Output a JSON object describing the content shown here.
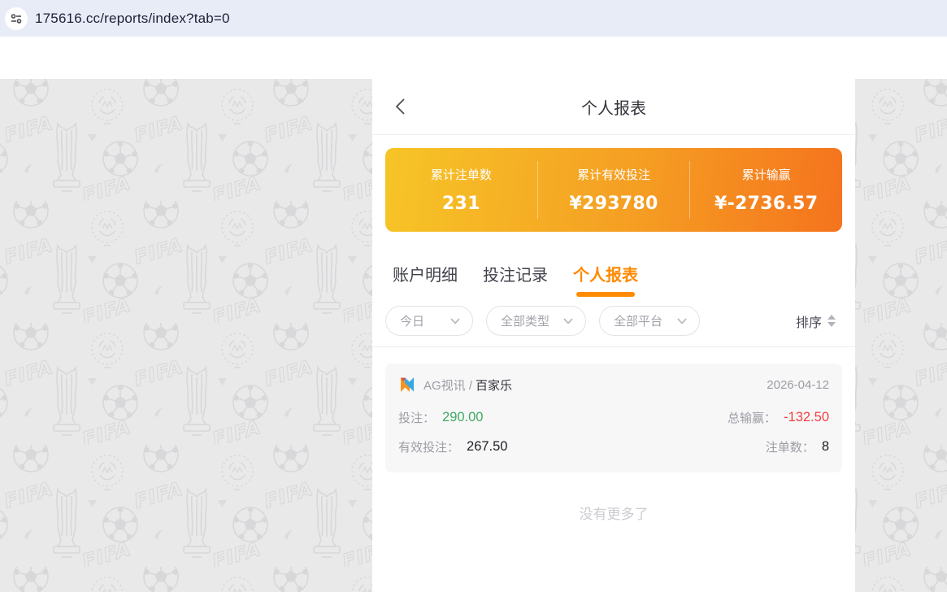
{
  "browser": {
    "url": "175616.cc/reports/index?tab=0"
  },
  "header": {
    "title": "个人报表"
  },
  "stats": {
    "items": [
      {
        "label": "累计注单数",
        "value": "231"
      },
      {
        "label": "累计有效投注",
        "value": "¥293780"
      },
      {
        "label": "累计输赢",
        "value": "¥-2736.57"
      }
    ]
  },
  "tabs": [
    {
      "label": "账户明细",
      "active": false
    },
    {
      "label": "投注记录",
      "active": false
    },
    {
      "label": "个人报表",
      "active": true
    }
  ],
  "filters": {
    "dropdowns": [
      {
        "value": "今日"
      },
      {
        "value": "全部类型"
      },
      {
        "value": "全部平台"
      }
    ],
    "sort_label": "排序"
  },
  "report": {
    "provider": "AG视讯 /",
    "game": "百家乐",
    "date": "2026-04-12",
    "bet_label": "投注：",
    "bet_value": "290.00",
    "winloss_label": "总输赢：",
    "winloss_value": "-132.50",
    "valid_bet_label": "有效投注：",
    "valid_bet_value": "267.50",
    "count_label": "注单数：",
    "count_value": "8"
  },
  "footer": {
    "no_more": "没有更多了"
  },
  "colors": {
    "accent": "#ff8a00",
    "gradient_start": "#f6c527",
    "gradient_end": "#f5731d",
    "positive_green": "#3fa963",
    "negative_red": "#f23d3d",
    "address_bar_bg": "#e8ecf7",
    "pattern_bg": "#e9e9ea",
    "pattern_glyph": "#d8d8da"
  }
}
